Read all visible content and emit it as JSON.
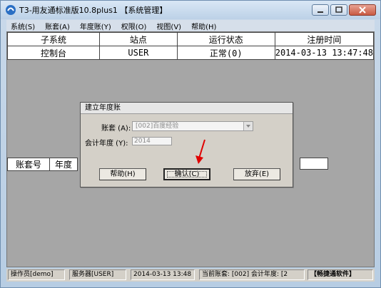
{
  "window": {
    "title": "T3-用友通标准版10.8plus1 【系统管理】"
  },
  "menu": [
    {
      "label": "系统(S)"
    },
    {
      "label": "账套(A)"
    },
    {
      "label": "年度账(Y)"
    },
    {
      "label": "权限(O)"
    },
    {
      "label": "视图(V)"
    },
    {
      "label": "帮助(H)"
    }
  ],
  "process_table": {
    "headers": [
      "子系统",
      "站点",
      "运行状态",
      "注册时间"
    ],
    "rows": [
      [
        "控制台",
        "USER",
        "正常(0)",
        "2014-03-13 13:47:48"
      ]
    ]
  },
  "account_table": {
    "headers": [
      "账套号",
      "年度"
    ]
  },
  "dialog": {
    "title": "建立年度账",
    "account_label": "账套 (A):",
    "account_value": "[002]百度经验",
    "year_label": "会计年度 (Y):",
    "year_value": "2014",
    "help_label": "帮助(H)",
    "confirm_label": "确认(C)",
    "abandon_label": "放弃(E)"
  },
  "statusbar": {
    "operator": "操作员[demo]",
    "server": "服务器[USER]",
    "datetime": "2014-03-13 13:48",
    "current": "当前账套: [002] 会计年度: [2",
    "brand": "【畅捷通软件】"
  },
  "colors": {
    "client_bg": "#a6a6a6",
    "dialog_bg": "#d4d0c8",
    "arrow": "#e00000"
  }
}
